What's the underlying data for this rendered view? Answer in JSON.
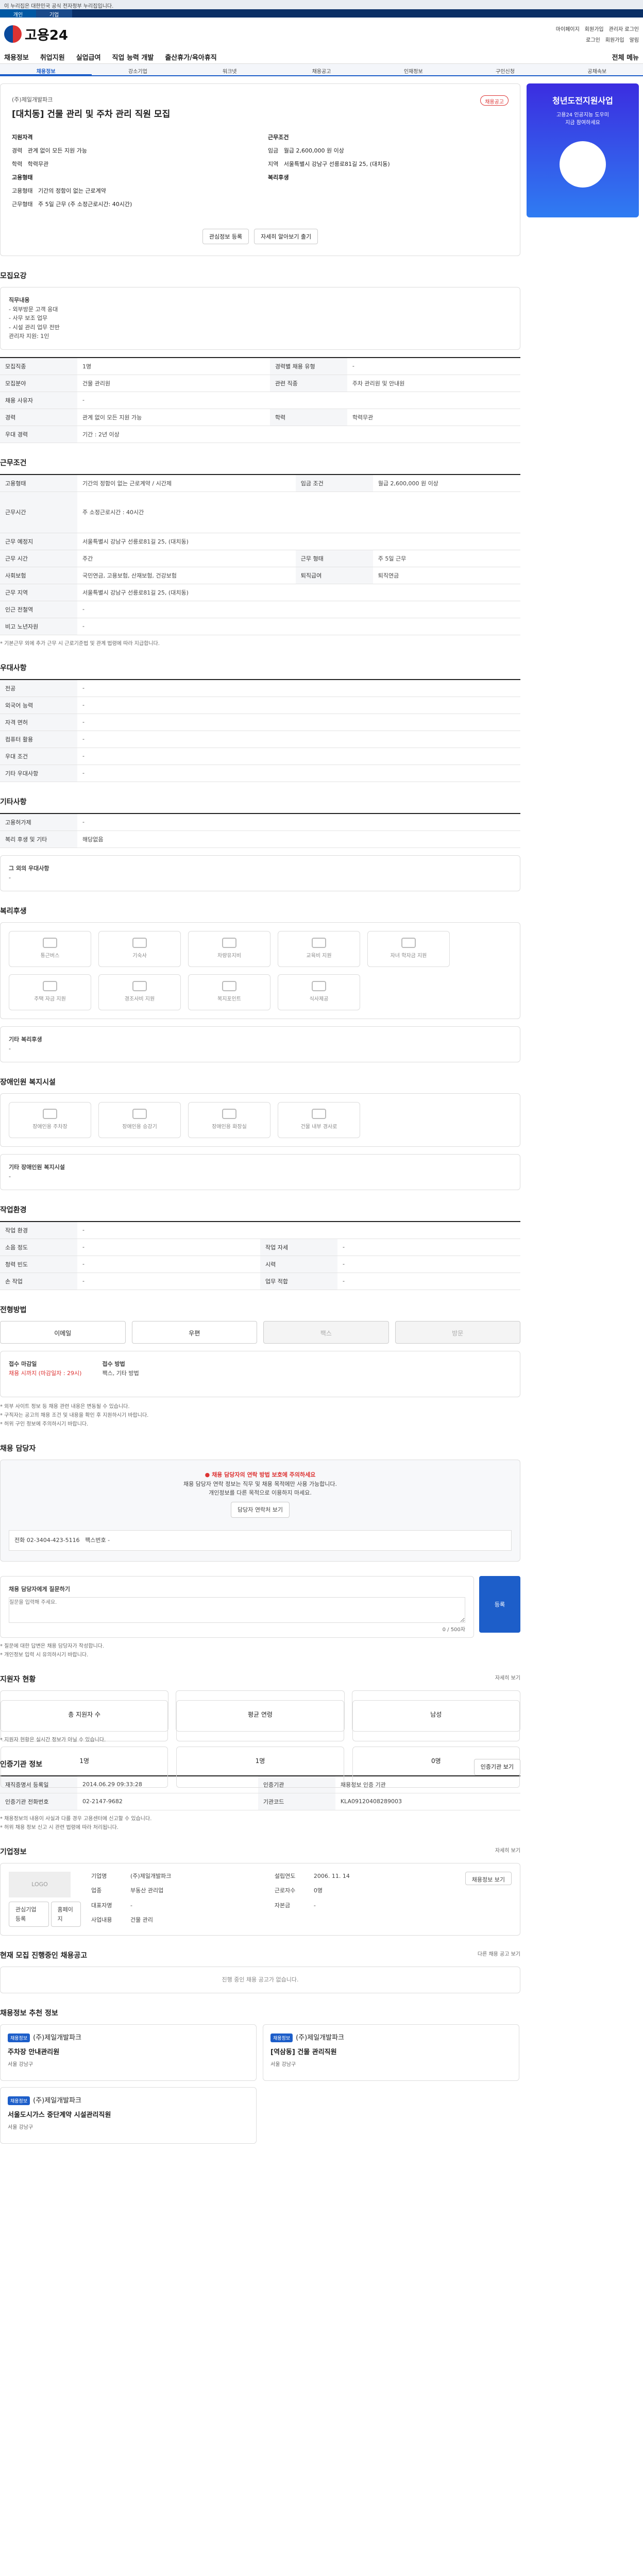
{
  "gov_bar": "이 누리집은 대한민국 공식 전자정부 누리집입니다.",
  "site_tabs": [
    "개인",
    "기업"
  ],
  "logo": "고용24",
  "header_links": [
    "마이페이지",
    "회원가입",
    "관리자 로그인"
  ],
  "header_icons": [
    "로그인",
    "회원가입",
    "알림"
  ],
  "nav": [
    "채용정보",
    "취업지원",
    "실업급여",
    "직업 능력 개발",
    "출산휴가/육아휴직"
  ],
  "nav_all": "전체 메뉴",
  "subnav": [
    "채용정보",
    "강소기업",
    "워크넷",
    "채용공고",
    "인재정보",
    "구인신청",
    "공채속보"
  ],
  "company": {
    "name": "(주)제일개발파크",
    "title": "[대치동] 건물 관리 및 주차 관리 직원 모집",
    "badge": "채용공고",
    "fields": [
      {
        "k": "지원자격",
        "v": ""
      },
      {
        "k": "근무조건",
        "v": ""
      },
      {
        "k": "경력",
        "v": "관계 없이 모든 지원 가능"
      },
      {
        "k": "임금",
        "v": "월급 2,600,000 원 이상"
      },
      {
        "k": "학력",
        "v": "학력무관"
      },
      {
        "k": "지역",
        "v": "서울특별시 강남구 선릉로81길 25, (대치동)"
      },
      {
        "k": "고용형태",
        "v": ""
      },
      {
        "k": "복리후생",
        "v": ""
      },
      {
        "k": "고용형태",
        "v": "기간의 정함이 없는 근로계약"
      },
      {
        "k": "근무형태",
        "v": "주 5일 근무 (주 소정근로시간: 40시간)"
      }
    ],
    "buttons": [
      "관심정보 등록",
      "자세히 알아보기 출기"
    ]
  },
  "banner": {
    "title": "청년도전지원사업",
    "line1": "고용24 인공지능 도우미",
    "line2": "지금 참여하세요"
  },
  "recruit_title": "모집요강",
  "duty": {
    "label": "직무내용",
    "items": [
      "- 외부방문 고객 응대",
      "- 사무 보조 업무",
      "- 시설 관리 업무 전반"
    ],
    "extra": "관리자 지원: 1인"
  },
  "recruit_rows": [
    [
      "모집직종",
      "1명",
      "경력별 채용 유형",
      "-"
    ],
    [
      "모집분야",
      "건물 관리원",
      "관련 직종",
      "주차 관리원 및 안내원"
    ],
    [
      "채용 사유자",
      "-",
      "",
      ""
    ],
    [
      "경력",
      "관계 없이 모든 지원 가능",
      "학력",
      "학력무관"
    ],
    [
      "우대 경력",
      "기간 : 2년 이상",
      "",
      ""
    ]
  ],
  "work_title": "근무조건",
  "work_rows": [
    [
      "고용형태",
      "기간의 정함이 없는 근로계약 / 시간제",
      "임금 조건",
      "월급 2,600,000 원 이상"
    ],
    [
      "근무시간",
      "주 소정근로시간 : 40시간",
      "",
      ""
    ],
    [
      "근무 예정지",
      "서울특별시 강남구 선릉로81길 25, (대치동)",
      "",
      ""
    ],
    [
      "근무 시간",
      "주간",
      "근무 형태",
      "주 5일 근무"
    ],
    [
      "사회보험",
      "국민연금, 고용보험, 산재보험, 건강보험",
      "퇴직급여",
      "퇴직연금"
    ],
    [
      "근무 지역",
      "서울특별시 강남구 선릉로81길 25, (대치동)",
      "",
      ""
    ],
    [
      "인근 전철역",
      "-",
      "",
      ""
    ],
    [
      "비고 노년자원",
      "-",
      "",
      ""
    ]
  ],
  "work_note": "* 기본근무 외에 추가 근무 시 근로기준법 및 관계 법령에 따라 지급합니다.",
  "pref_title": "우대사항",
  "pref_rows": [
    [
      "전공",
      "-"
    ],
    [
      "외국어 능력",
      "-"
    ],
    [
      "자격 면허",
      "-"
    ],
    [
      "컴퓨터 활용",
      "-"
    ],
    [
      "우대 조건",
      "-"
    ],
    [
      "기타 우대사항",
      "-"
    ]
  ],
  "etc_title": "기타사항",
  "etc_rows": [
    [
      "고용허가제",
      "-"
    ],
    [
      "복리 후생 및 기타",
      "해당없음"
    ]
  ],
  "etc_detail": {
    "label": "그 외의 우대사항",
    "value": "-"
  },
  "welfare_title": "복리후생",
  "welfare_icons": [
    "통근버스",
    "기숙사",
    "차량유지비",
    "교육비 지원",
    "자녀 학자금 지원",
    "주택 자금 지원",
    "경조사비 지원",
    "복지포인트",
    "식사제공"
  ],
  "welfare_other": {
    "label": "기타 복리후생",
    "value": "-"
  },
  "disability_title": "장애인원 복지시설",
  "disability_icons": [
    "장애인용 주차장",
    "장애인용 승강기",
    "장애인용 화장실",
    "건물 내부 경사로"
  ],
  "disability_other": {
    "label": "기타 장애인원 복지시설",
    "value": "-"
  },
  "env_title": "작업환경",
  "env_rows": [
    [
      "작업 환경",
      "-",
      "",
      ""
    ],
    [
      "소음 정도",
      "-",
      "작업 자세",
      "-"
    ],
    [
      "청력 빈도",
      "-",
      "시력",
      "-"
    ],
    [
      "손 작업",
      "-",
      "업무 적합",
      "-"
    ]
  ],
  "apply_title": "전형방법",
  "apply_methods": [
    "이메일",
    "우편",
    "팩스",
    "방문"
  ],
  "apply_info": [
    {
      "k": "접수 마감일",
      "v": "채용 시까지 (마감일자 : 29시)"
    },
    {
      "k": "접수 방법",
      "v": "팩스, 기타 방법"
    }
  ],
  "apply_notes": [
    "* 외부 사이트 정보 등 채용 관련 내용은 변동될 수 있습니다.",
    "* 구직자는 공고의 채용 조건 및 내용을 확인 후 지원하시기 바랍니다.",
    "* 허위 구인 정보에 주의하시기 바랍니다."
  ],
  "contact_title": "채용 담당자",
  "contact_box": {
    "warn": "채용 담당자의 연락 방법 보호에 주의하세요",
    "line1": "채용 담당자 연락 정보는 직무 및 채용 목적에만 사용 가능합니다.",
    "line2": "개인정보를 다른 목적으로 이용하지 마세요.",
    "btn": "담당자 연락처 보기",
    "phone_label": "전화",
    "phone": "02-3404-423-5116",
    "fax_label": "팩스번호",
    "fax": "-"
  },
  "qna": {
    "title": "채용 담당자에게 질문하기",
    "placeholder": "질문을 입력해 주세요.",
    "count": "0 / 500자",
    "btn": "등록"
  },
  "qna_notes": [
    "* 질문에 대한 답변은 채용 담당자가 작성합니다.",
    "* 개인정보 입력 시 유의하시기 바랍니다."
  ],
  "applicant_title": "지원자 현황",
  "applicant_more": "자세히 보기",
  "applicant_stats": [
    {
      "k": "총 지원자 수",
      "v": "1명"
    },
    {
      "k": "평균 연령",
      "v": "1명"
    },
    {
      "k": "남성",
      "v": "0명"
    }
  ],
  "applicant_note": "* 지원자 현황은 실시간 정보가 아닐 수 있습니다.",
  "org_title": "인증기관 정보",
  "org_btn": "인증기관 보기",
  "org_rows": [
    [
      "재직증명서 등록일",
      "2014.06.29 09:33:28",
      "인증기관",
      "채용정보 인증 기관"
    ],
    [
      "인증기관 전화번호",
      "02-2147-9682",
      "기관코드",
      "KLA09120408289003"
    ]
  ],
  "org_notes": [
    "* 채용정보의 내용이 사실과 다를 경우 고용센터에 신고할 수 있습니다.",
    "* 허위 채용 정보 신고 시 관련 법령에 따라 처리됩니다."
  ],
  "corp_title": "기업정보",
  "corp_more": "자세히 보기",
  "corp_logo": "LOGO",
  "corp_rows": [
    [
      "기업명",
      "(주)제일개발파크",
      "설립연도",
      "2006. 11. 14"
    ],
    [
      "업종",
      "부동산 관리업",
      "근로자수",
      "0명"
    ],
    [
      "대표자명",
      "-",
      "자본금",
      "-"
    ],
    [
      "사업내용",
      "건물 관리"
    ]
  ],
  "corp_btns": [
    "관심기업 등록",
    "홈페이지"
  ],
  "corp_right_btn": "채용정보 보기",
  "other_title": "현재 모집 진행중인 채용공고",
  "other_more": "다른 채용 공고 보기",
  "other_empty": "진행 중인 채용 공고가 없습니다.",
  "recommend_title": "채용정보 추천 정보",
  "recommend": [
    {
      "tag": "채용정보",
      "co": "(주)제일개발파크",
      "title": "주차장 안내관리원",
      "loc": "서울 강남구"
    },
    {
      "tag": "채용정보",
      "co": "(주)제일개발파크",
      "title": "[역삼동] 건물 관리직원",
      "loc": "서울 강남구"
    },
    {
      "tag": "채용정보",
      "co": "(주)제일개발파크",
      "title": "서울도시가스 중단계약 시설관리직원",
      "loc": "서울 강남구"
    }
  ]
}
